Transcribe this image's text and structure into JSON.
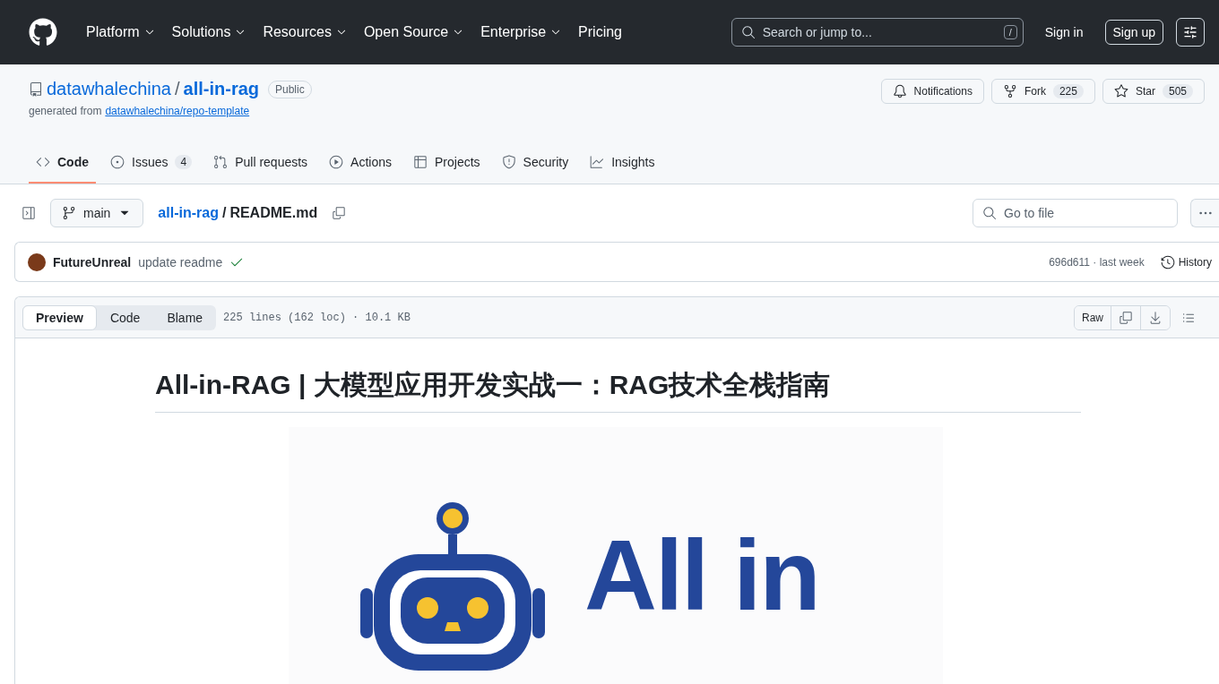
{
  "header": {
    "nav": [
      {
        "label": "Platform",
        "dropdown": true
      },
      {
        "label": "Solutions",
        "dropdown": true
      },
      {
        "label": "Resources",
        "dropdown": true
      },
      {
        "label": "Open Source",
        "dropdown": true
      },
      {
        "label": "Enterprise",
        "dropdown": true
      },
      {
        "label": "Pricing",
        "dropdown": false
      }
    ],
    "search": {
      "placeholder": "Search or jump to...",
      "shortcut": "/"
    },
    "sign_in": "Sign in",
    "sign_up": "Sign up"
  },
  "repo": {
    "owner": "datawhalechina",
    "separator": "/",
    "name": "all-in-rag",
    "visibility": "Public",
    "generated_from_label": "generated from",
    "generated_from_link": "datawhalechina/repo-template",
    "actions": [
      {
        "kind": "notifications",
        "label": "Notifications"
      },
      {
        "kind": "fork",
        "label": "Fork",
        "count": "225"
      },
      {
        "kind": "star",
        "label": "Star",
        "count": "505"
      }
    ]
  },
  "tabs": [
    {
      "kind": "code",
      "label": "Code",
      "selected": true
    },
    {
      "kind": "issues",
      "label": "Issues",
      "count": "4",
      "selected": false
    },
    {
      "kind": "pulls",
      "label": "Pull requests",
      "selected": false
    },
    {
      "kind": "actions",
      "label": "Actions",
      "selected": false
    },
    {
      "kind": "projects",
      "label": "Projects",
      "selected": false
    },
    {
      "kind": "security",
      "label": "Security",
      "selected": false
    },
    {
      "kind": "insights",
      "label": "Insights",
      "selected": false
    }
  ],
  "file_nav": {
    "branch": "main",
    "breadcrumb_root": "all-in-rag",
    "separator": "/",
    "file": "README.md",
    "search": {
      "placeholder": "Go to file"
    }
  },
  "commit": {
    "author": "FutureUnreal",
    "message": "update readme",
    "checks_passed": true,
    "sha_time": "696d611 · last week",
    "history": "History"
  },
  "file_header": {
    "view_modes": [
      {
        "label": "Preview",
        "selected": true
      },
      {
        "label": "Code",
        "selected": false
      },
      {
        "label": "Blame",
        "selected": false
      }
    ],
    "info": "225 lines (162 loc) · 10.1 KB",
    "raw": "Raw"
  },
  "readme": {
    "title": "All-in-RAG | 大模型应用开发实战一：RAG技术全栈指南",
    "logo_text": "All in"
  }
}
